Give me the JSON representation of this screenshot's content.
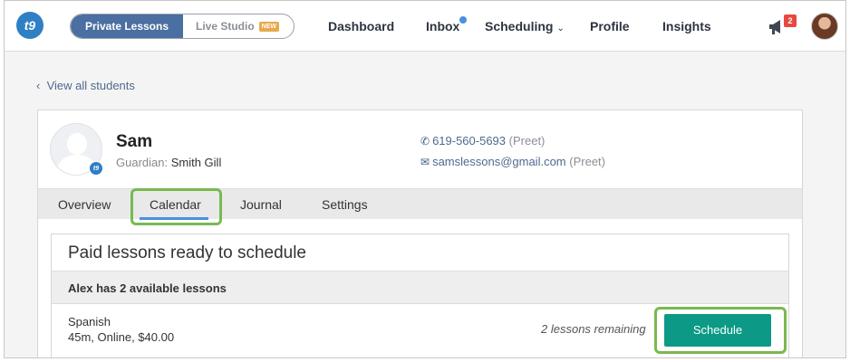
{
  "nav": {
    "logo_text": "t9",
    "segment_active": "Private Lessons",
    "segment_inactive": "Live Studio",
    "new_badge": "NEW",
    "links": [
      "Dashboard",
      "Inbox",
      "Scheduling",
      "Profile",
      "Insights"
    ],
    "notification_count": "2",
    "icons": {
      "scheduling_dropdown": "chevron-down-icon",
      "announcements": "megaphone-icon",
      "inbox_unread": "unread-dot-icon"
    }
  },
  "back_link": "View all students",
  "student": {
    "name": "Sam",
    "guardian_label": "Guardian:",
    "guardian_name": "Smith Gill",
    "phone": "619-560-5693",
    "phone_note": "(Preet)",
    "email": "samslessons@gmail.com",
    "email_note": "(Preet)"
  },
  "tabs": [
    "Overview",
    "Calendar",
    "Journal",
    "Settings"
  ],
  "active_tab": "Calendar",
  "paid_lessons": {
    "title": "Paid lessons ready to schedule",
    "header": "Alex has 2 available lessons",
    "lesson_name": "Spanish",
    "lesson_meta": "45m, Online, $40.00",
    "remaining": "2 lessons remaining",
    "schedule_label": "Schedule"
  },
  "colors": {
    "accent_blue": "#4b6fa0",
    "schedule_green": "#0c9a86",
    "highlight_green": "#79b94f",
    "badge_red": "#e8493f"
  }
}
